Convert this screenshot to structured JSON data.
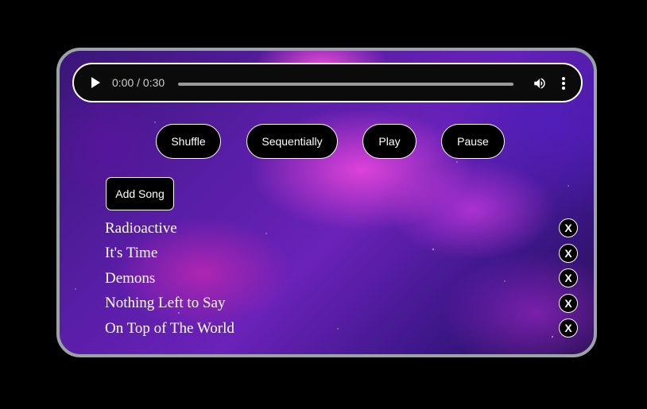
{
  "audio_player": {
    "time_display": "0:00 / 0:30",
    "progress": 0,
    "play_icon": "play-icon",
    "volume_icon": "volume-icon",
    "more_icon": "more-vert-icon"
  },
  "controls": {
    "shuffle_label": "Shuffle",
    "sequential_label": "Sequentially",
    "play_label": "Play",
    "pause_label": "Pause"
  },
  "add_song_label": "Add Song",
  "songs": [
    {
      "title": "Radioactive",
      "remove_label": "X"
    },
    {
      "title": "It's Time",
      "remove_label": "X"
    },
    {
      "title": "Demons",
      "remove_label": "X"
    },
    {
      "title": "Nothing Left to Say",
      "remove_label": "X"
    },
    {
      "title": "On Top of The World",
      "remove_label": "X"
    }
  ],
  "colors": {
    "page_background": "#000000",
    "card_border": "#9aa3a6",
    "button_background": "#000000",
    "button_text": "#ffffff"
  }
}
